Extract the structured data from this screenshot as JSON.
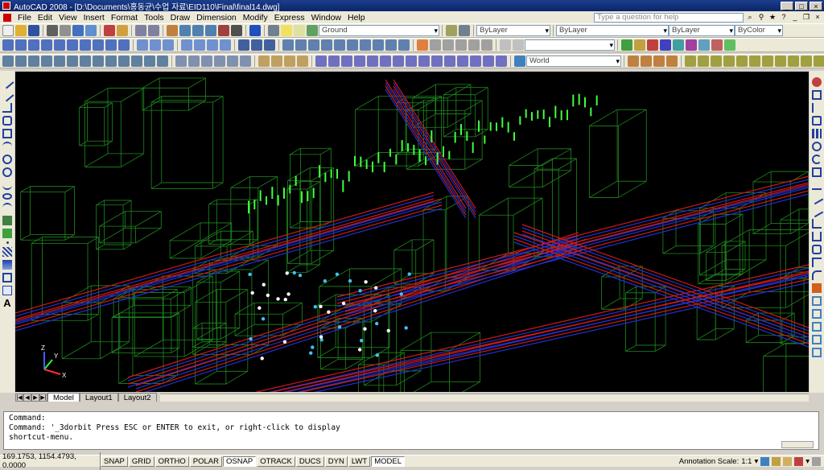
{
  "titlebar": {
    "title": "AutoCAD 2008 - [D:\\Documents\\홍동균\\수업 자료\\EID110\\Final\\final14.dwg]",
    "minimize": "_",
    "maximize": "□",
    "close": "×"
  },
  "menubar": {
    "items": [
      "File",
      "Edit",
      "View",
      "Insert",
      "Format",
      "Tools",
      "Draw",
      "Dimension",
      "Modify",
      "Express",
      "Window",
      "Help"
    ],
    "help_placeholder": "Type a question for help"
  },
  "toolbar1": {
    "layer_combo": "Ground",
    "color_combo": "ByLayer",
    "linetype_combo": "ByLayer",
    "lineweight_combo": "ByLayer",
    "plotstyle_combo": "ByColor"
  },
  "toolbar3": {
    "ucs_combo": "World"
  },
  "layout_tabs": {
    "tabs": [
      "Model",
      "Layout1",
      "Layout2"
    ]
  },
  "command": {
    "lines": [
      "Command:",
      "Command: '_3dorbit Press ESC or ENTER to exit, or right-click to display",
      "shortcut-menu."
    ]
  },
  "statusbar": {
    "coords": "169.1753, 1154.4793, 0.0000",
    "buttons": [
      {
        "label": "SNAP",
        "on": false
      },
      {
        "label": "GRID",
        "on": false
      },
      {
        "label": "ORTHO",
        "on": false
      },
      {
        "label": "POLAR",
        "on": false
      },
      {
        "label": "OSNAP",
        "on": true
      },
      {
        "label": "OTRACK",
        "on": false
      },
      {
        "label": "DUCS",
        "on": false
      },
      {
        "label": "DYN",
        "on": false
      },
      {
        "label": "LWT",
        "on": false
      },
      {
        "label": "MODEL",
        "on": true
      }
    ],
    "annotation_scale_label": "Annotation Scale:",
    "annotation_scale_value": "1:1"
  },
  "ucs_icon": {
    "x_label": "X",
    "y_label": "Y",
    "z_label": "Z"
  },
  "colors": {
    "viewport_bg": "#000000",
    "building_green": "#1f8a1f",
    "road_red": "#d01818",
    "road_blue": "#2030d0",
    "tree_green": "#40ff40"
  }
}
